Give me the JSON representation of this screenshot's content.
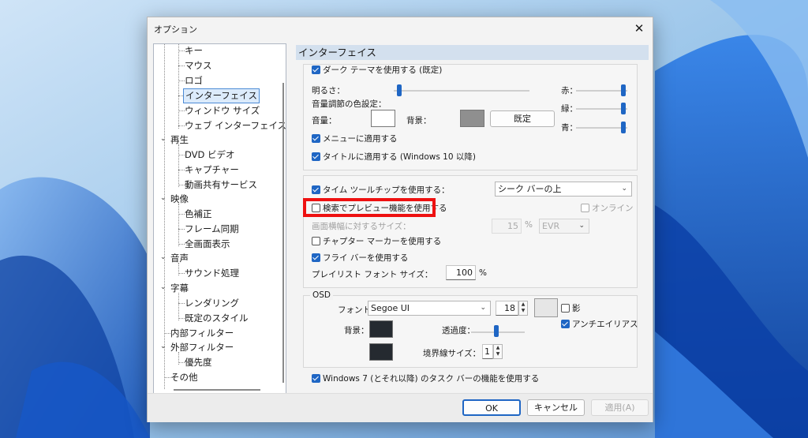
{
  "window": {
    "title": "オプション"
  },
  "tree": {
    "items": [
      "キー",
      "マウス",
      "ロゴ",
      "インターフェイス",
      "ウィンドウ サイズ",
      "ウェブ インターフェイス",
      "再生",
      "DVD ビデオ",
      "キャプチャー",
      "動画共有サービス",
      "映像",
      "色補正",
      "フレーム同期",
      "全画面表示",
      "音声",
      "サウンド処理",
      "字幕",
      "レンダリング",
      "既定のスタイル",
      "内部フィルター",
      "外部フィルター",
      "優先度",
      "その他"
    ],
    "selected": "インターフェイス"
  },
  "panel": {
    "heading": "インターフェイス",
    "theme": {
      "dark_theme_label": "ダーク テーマを使用する (既定)",
      "brightness_label": "明るさ：",
      "red_label": "赤：",
      "green_label": "緑：",
      "blue_label": "青：",
      "volume_color_label": "音量調節の色設定：",
      "volume_label": "音量：",
      "background_label": "背景：",
      "default_button": "既定",
      "apply_menu_label": "メニューに適用する",
      "apply_title_label": "タイトルに適用する (Windows 10 以降)",
      "background_swatch_color": "#8f8f8f"
    },
    "seekbar": {
      "time_tooltip_label": "タイム ツールチップを使用する：",
      "tooltip_position": "シーク バーの上",
      "preview_label": "検索でプレビュー機能を使用する",
      "online_label": "オンライン",
      "preview_size_label": "画面横幅に対するサイズ：",
      "preview_size_value": "15",
      "percent_symbol": "%",
      "renderer_value": "EVR",
      "chapter_label": "チャプター マーカーを使用する",
      "flybar_label": "フライ バーを使用する",
      "playlist_font_label": "プレイリスト フォント サイズ：",
      "playlist_font_value": "100",
      "playlist_percent": "%"
    },
    "osd": {
      "group_title": "OSD",
      "font_label": "フォント：",
      "font_value": "Segoe UI",
      "font_size": "18",
      "shadow_label": "影",
      "antialias_label": "アンチエイリアス",
      "background_label": "背景：",
      "transparency_label": "透過度：",
      "border_size_label": "境界線サイズ：",
      "border_size_value": "1",
      "bg_color": "#252a30"
    },
    "taskbar_label": "Windows 7 (とそれ以降) のタスク バーの機能を使用する"
  },
  "buttons": {
    "ok": "OK",
    "cancel": "キャンセル",
    "apply": "適用(A)"
  },
  "accent": "#1f66c4",
  "highlight": "#ee1111"
}
